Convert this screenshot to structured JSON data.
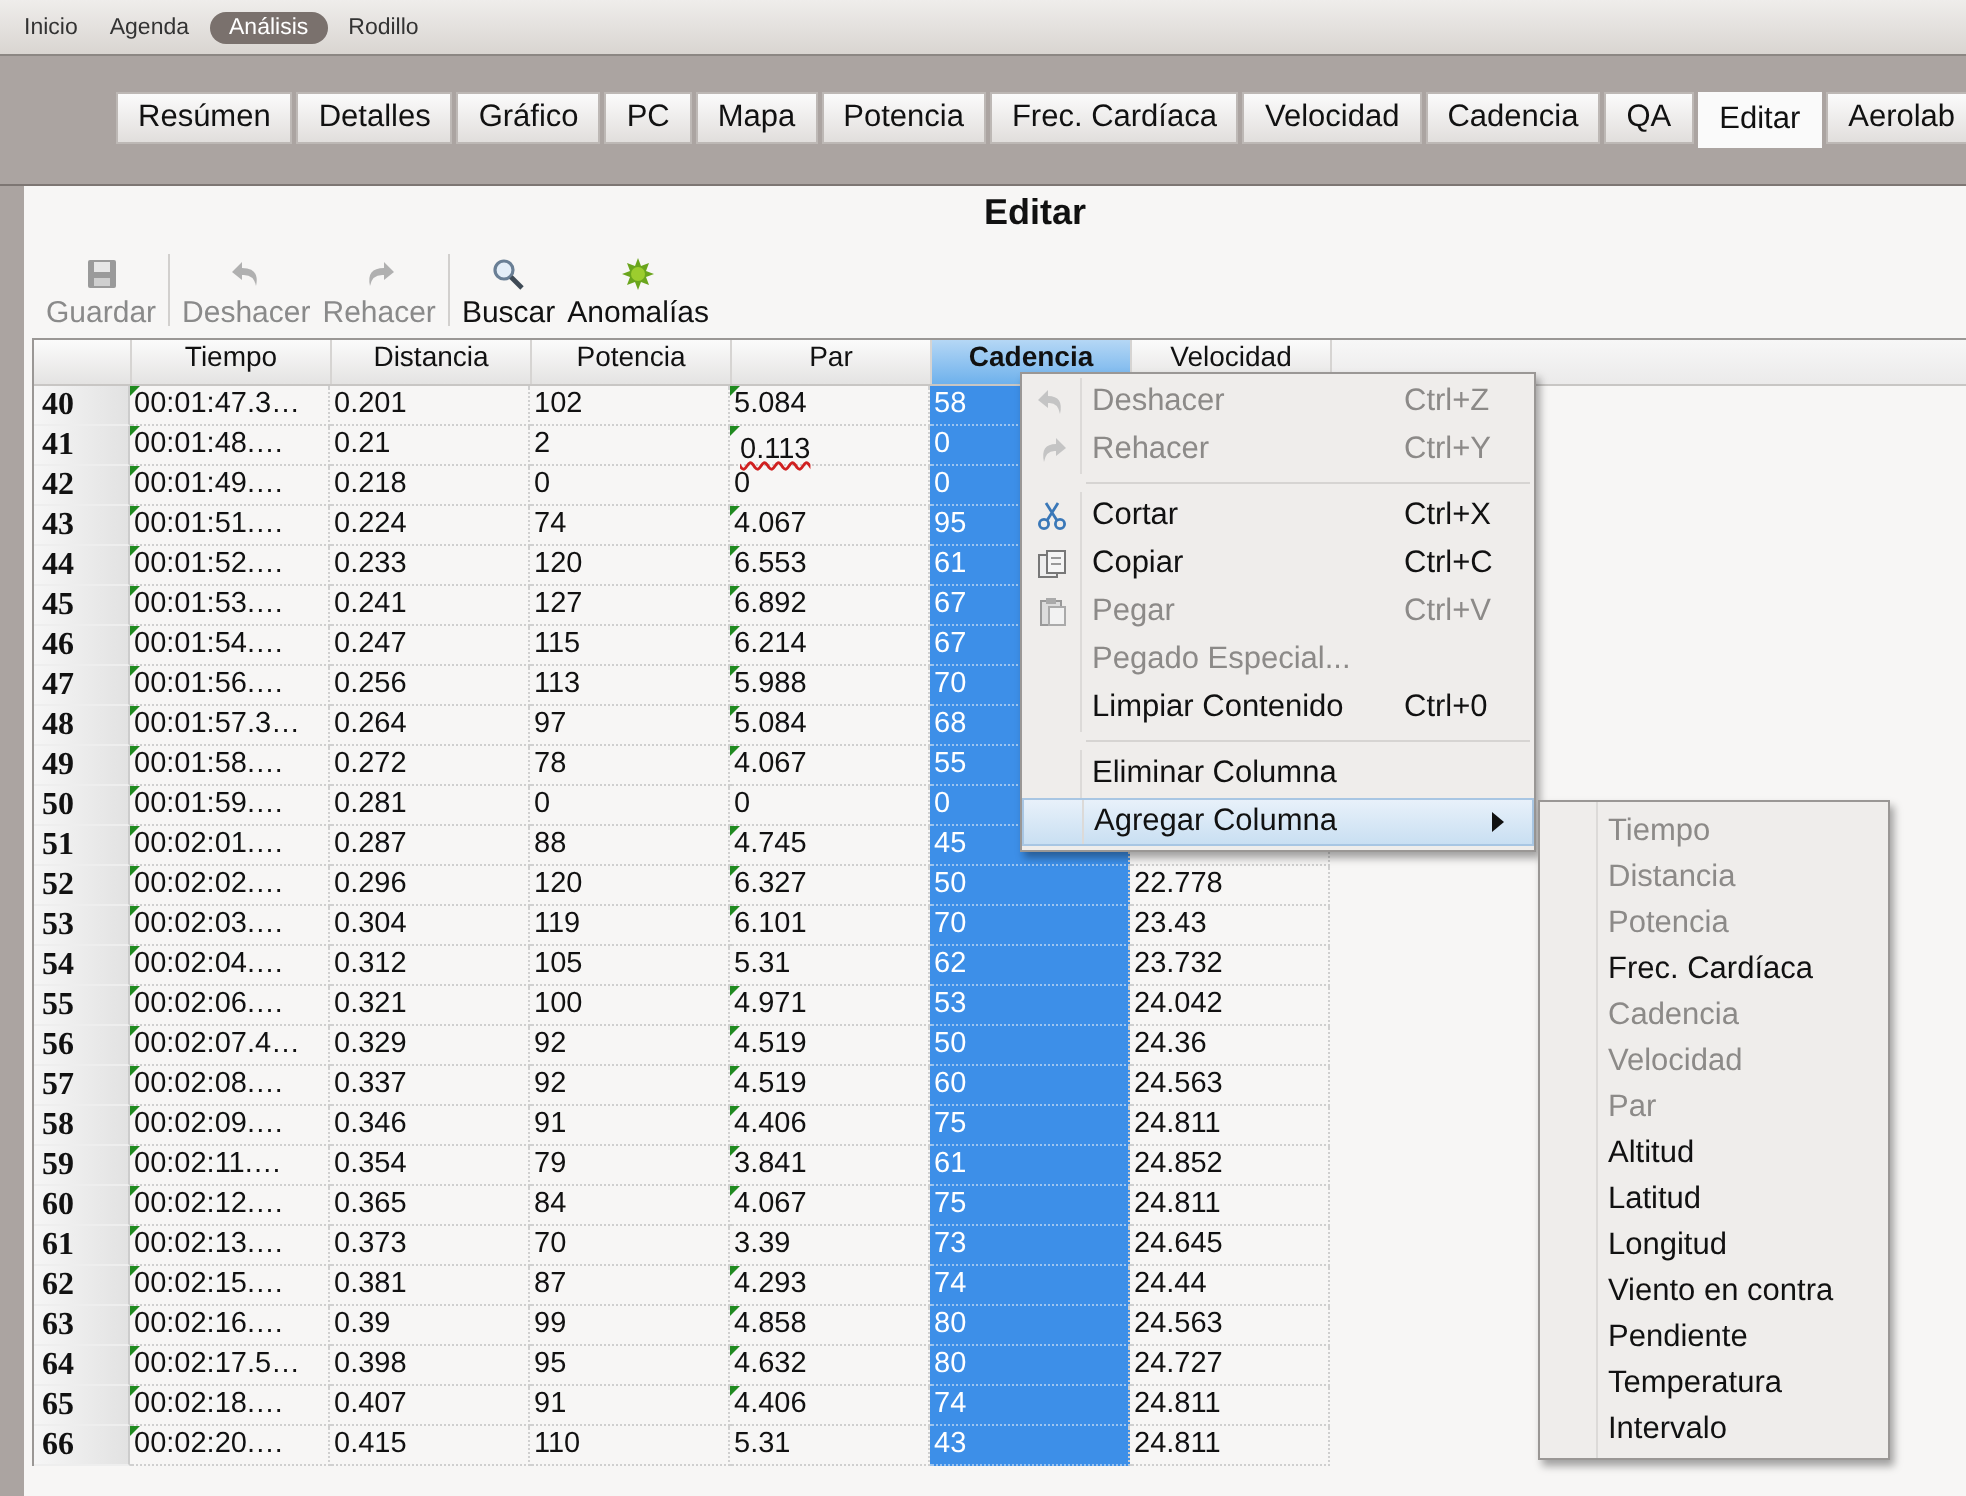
{
  "nav": [
    {
      "label": "Inicio",
      "selected": false
    },
    {
      "label": "Agenda",
      "selected": false
    },
    {
      "label": "Análisis",
      "selected": true
    },
    {
      "label": "Rodillo",
      "selected": false
    }
  ],
  "tabs": [
    {
      "label": "Resúmen",
      "selected": false
    },
    {
      "label": "Detalles",
      "selected": false
    },
    {
      "label": "Gráfico",
      "selected": false
    },
    {
      "label": "PC",
      "selected": false
    },
    {
      "label": "Mapa",
      "selected": false
    },
    {
      "label": "Potencia",
      "selected": false
    },
    {
      "label": "Frec. Cardíaca",
      "selected": false
    },
    {
      "label": "Velocidad",
      "selected": false
    },
    {
      "label": "Cadencia",
      "selected": false
    },
    {
      "label": "QA",
      "selected": false
    },
    {
      "label": "Editar",
      "selected": true
    },
    {
      "label": "Aerolab",
      "selected": false
    }
  ],
  "panel": {
    "title": "Editar",
    "toolbar": [
      {
        "kind": "button",
        "label": "Guardar",
        "disabled": true
      },
      {
        "kind": "separator"
      },
      {
        "kind": "button",
        "label": "Deshacer",
        "disabled": true
      },
      {
        "kind": "button",
        "label": "Rehacer",
        "disabled": true
      },
      {
        "kind": "separator"
      },
      {
        "kind": "button",
        "label": "Buscar",
        "disabled": false
      },
      {
        "kind": "button",
        "label": "Anomalías",
        "disabled": false
      }
    ]
  },
  "table": {
    "columns": [
      {
        "label": "Tiempo",
        "selected": false
      },
      {
        "label": "Distancia",
        "selected": false
      },
      {
        "label": "Potencia",
        "selected": false
      },
      {
        "label": "Par",
        "selected": false
      },
      {
        "label": "Cadencia",
        "selected": true
      },
      {
        "label": "Velocidad",
        "selected": false
      }
    ],
    "rows": [
      {
        "label": "40",
        "cells": [
          "00:01:47.3…",
          "0.201",
          "102",
          "5.084",
          "58"
        ],
        "time_marked": true,
        "torque_marked": true
      },
      {
        "label": "41",
        "cells": [
          "00:01:48.…",
          "0.21",
          "2",
          "0.113",
          "0"
        ],
        "time_marked": true,
        "torque_marked": true,
        "torque_underlined": true
      },
      {
        "label": "42",
        "cells": [
          "00:01:49.…",
          "0.218",
          "0",
          "0",
          "0"
        ],
        "time_marked": true,
        "torque_marked": false
      },
      {
        "label": "43",
        "cells": [
          "00:01:51.…",
          "0.224",
          "74",
          "4.067",
          "95"
        ],
        "time_marked": true,
        "torque_marked": true
      },
      {
        "label": "44",
        "cells": [
          "00:01:52.…",
          "0.233",
          "120",
          "6.553",
          "61"
        ],
        "time_marked": true,
        "torque_marked": true
      },
      {
        "label": "45",
        "cells": [
          "00:01:53.…",
          "0.241",
          "127",
          "6.892",
          "67"
        ],
        "time_marked": true,
        "torque_marked": true
      },
      {
        "label": "46",
        "cells": [
          "00:01:54.…",
          "0.247",
          "115",
          "6.214",
          "67"
        ],
        "time_marked": true,
        "torque_marked": true
      },
      {
        "label": "47",
        "cells": [
          "00:01:56.…",
          "0.256",
          "113",
          "5.988",
          "70"
        ],
        "time_marked": true,
        "torque_marked": true
      },
      {
        "label": "48",
        "cells": [
          "00:01:57.3…",
          "0.264",
          "97",
          "5.084",
          "68"
        ],
        "time_marked": true,
        "torque_marked": true
      },
      {
        "label": "49",
        "cells": [
          "00:01:58.…",
          "0.272",
          "78",
          "4.067",
          "55"
        ],
        "time_marked": true,
        "torque_marked": true
      },
      {
        "label": "50",
        "cells": [
          "00:01:59.…",
          "0.281",
          "0",
          "0",
          "0"
        ],
        "time_marked": true,
        "torque_marked": false
      },
      {
        "label": "51",
        "cells": [
          "00:02:01.…",
          "0.287",
          "88",
          "4.745",
          "45"
        ],
        "time_marked": true,
        "torque_marked": true
      },
      {
        "label": "52",
        "cells": [
          "00:02:02.…",
          "0.296",
          "120",
          "6.327",
          "50",
          "22.778"
        ],
        "time_marked": true,
        "torque_marked": true
      },
      {
        "label": "53",
        "cells": [
          "00:02:03.…",
          "0.304",
          "119",
          "6.101",
          "70",
          "23.43"
        ],
        "time_marked": true,
        "torque_marked": true
      },
      {
        "label": "54",
        "cells": [
          "00:02:04.…",
          "0.312",
          "105",
          "5.31",
          "62",
          "23.732"
        ],
        "time_marked": true,
        "torque_marked": false
      },
      {
        "label": "55",
        "cells": [
          "00:02:06.…",
          "0.321",
          "100",
          "4.971",
          "53",
          "24.042"
        ],
        "time_marked": true,
        "torque_marked": true
      },
      {
        "label": "56",
        "cells": [
          "00:02:07.4…",
          "0.329",
          "92",
          "4.519",
          "50",
          "24.36"
        ],
        "time_marked": true,
        "torque_marked": true
      },
      {
        "label": "57",
        "cells": [
          "00:02:08.…",
          "0.337",
          "92",
          "4.519",
          "60",
          "24.563"
        ],
        "time_marked": true,
        "torque_marked": true
      },
      {
        "label": "58",
        "cells": [
          "00:02:09.…",
          "0.346",
          "91",
          "4.406",
          "75",
          "24.811"
        ],
        "time_marked": true,
        "torque_marked": true
      },
      {
        "label": "59",
        "cells": [
          "00:02:11.…",
          "0.354",
          "79",
          "3.841",
          "61",
          "24.852"
        ],
        "time_marked": true,
        "torque_marked": true
      },
      {
        "label": "60",
        "cells": [
          "00:02:12.…",
          "0.365",
          "84",
          "4.067",
          "75",
          "24.811"
        ],
        "time_marked": true,
        "torque_marked": true
      },
      {
        "label": "61",
        "cells": [
          "00:02:13.…",
          "0.373",
          "70",
          "3.39",
          "73",
          "24.645"
        ],
        "time_marked": true,
        "torque_marked": false
      },
      {
        "label": "62",
        "cells": [
          "00:02:15.…",
          "0.381",
          "87",
          "4.293",
          "74",
          "24.44"
        ],
        "time_marked": true,
        "torque_marked": true
      },
      {
        "label": "63",
        "cells": [
          "00:02:16.…",
          "0.39",
          "99",
          "4.858",
          "80",
          "24.563"
        ],
        "time_marked": true,
        "torque_marked": true
      },
      {
        "label": "64",
        "cells": [
          "00:02:17.5…",
          "0.398",
          "95",
          "4.632",
          "80",
          "24.727"
        ],
        "time_marked": true,
        "torque_marked": true
      },
      {
        "label": "65",
        "cells": [
          "00:02:18.…",
          "0.407",
          "91",
          "4.406",
          "74",
          "24.811"
        ],
        "time_marked": true,
        "torque_marked": true
      },
      {
        "label": "66",
        "cells": [
          "00:02:20.…",
          "0.415",
          "110",
          "5.31",
          "43",
          "24.811"
        ],
        "time_marked": true,
        "torque_marked": false
      }
    ]
  },
  "context_menu": {
    "items": [
      {
        "kind": "item",
        "label": "Deshacer",
        "shortcut": "Ctrl+Z",
        "disabled": true,
        "selected": false
      },
      {
        "kind": "item",
        "label": "Rehacer",
        "shortcut": "Ctrl+Y",
        "disabled": true,
        "selected": false
      },
      {
        "kind": "separator"
      },
      {
        "kind": "item",
        "label": "Cortar",
        "shortcut": "Ctrl+X",
        "disabled": false,
        "selected": false
      },
      {
        "kind": "item",
        "label": "Copiar",
        "shortcut": "Ctrl+C",
        "disabled": false,
        "selected": false
      },
      {
        "kind": "item",
        "label": "Pegar",
        "shortcut": "Ctrl+V",
        "disabled": true,
        "selected": false
      },
      {
        "kind": "item",
        "label": "Pegado Especial...",
        "disabled": true,
        "selected": false
      },
      {
        "kind": "item",
        "label": "Limpiar Contenido",
        "shortcut": "Ctrl+0",
        "disabled": false,
        "selected": false
      },
      {
        "kind": "separator"
      },
      {
        "kind": "item",
        "label": "Eliminar Columna",
        "disabled": false,
        "selected": false
      },
      {
        "kind": "submenu",
        "label": "Agregar Columna",
        "disabled": false,
        "selected": true
      }
    ]
  },
  "submenu": {
    "items": [
      {
        "label": "Tiempo",
        "disabled": true,
        "selected": false
      },
      {
        "label": "Distancia",
        "disabled": true,
        "selected": false
      },
      {
        "label": "Potencia",
        "disabled": true,
        "selected": false
      },
      {
        "label": "Frec. Cardíaca",
        "disabled": false,
        "selected": false
      },
      {
        "label": "Cadencia",
        "disabled": true,
        "selected": false
      },
      {
        "label": "Velocidad",
        "disabled": true,
        "selected": false
      },
      {
        "label": "Par",
        "disabled": true,
        "selected": false
      },
      {
        "label": "Altitud",
        "disabled": false,
        "selected": false
      },
      {
        "label": "Latitud",
        "disabled": false,
        "selected": false
      },
      {
        "label": "Longitud",
        "disabled": false,
        "selected": false
      },
      {
        "label": "Viento en contra",
        "disabled": false,
        "selected": false
      },
      {
        "label": "Pendiente",
        "disabled": false,
        "selected": false
      },
      {
        "label": "Temperatura",
        "disabled": false,
        "selected": false
      },
      {
        "label": "Intervalo",
        "disabled": false,
        "selected": false
      }
    ]
  }
}
